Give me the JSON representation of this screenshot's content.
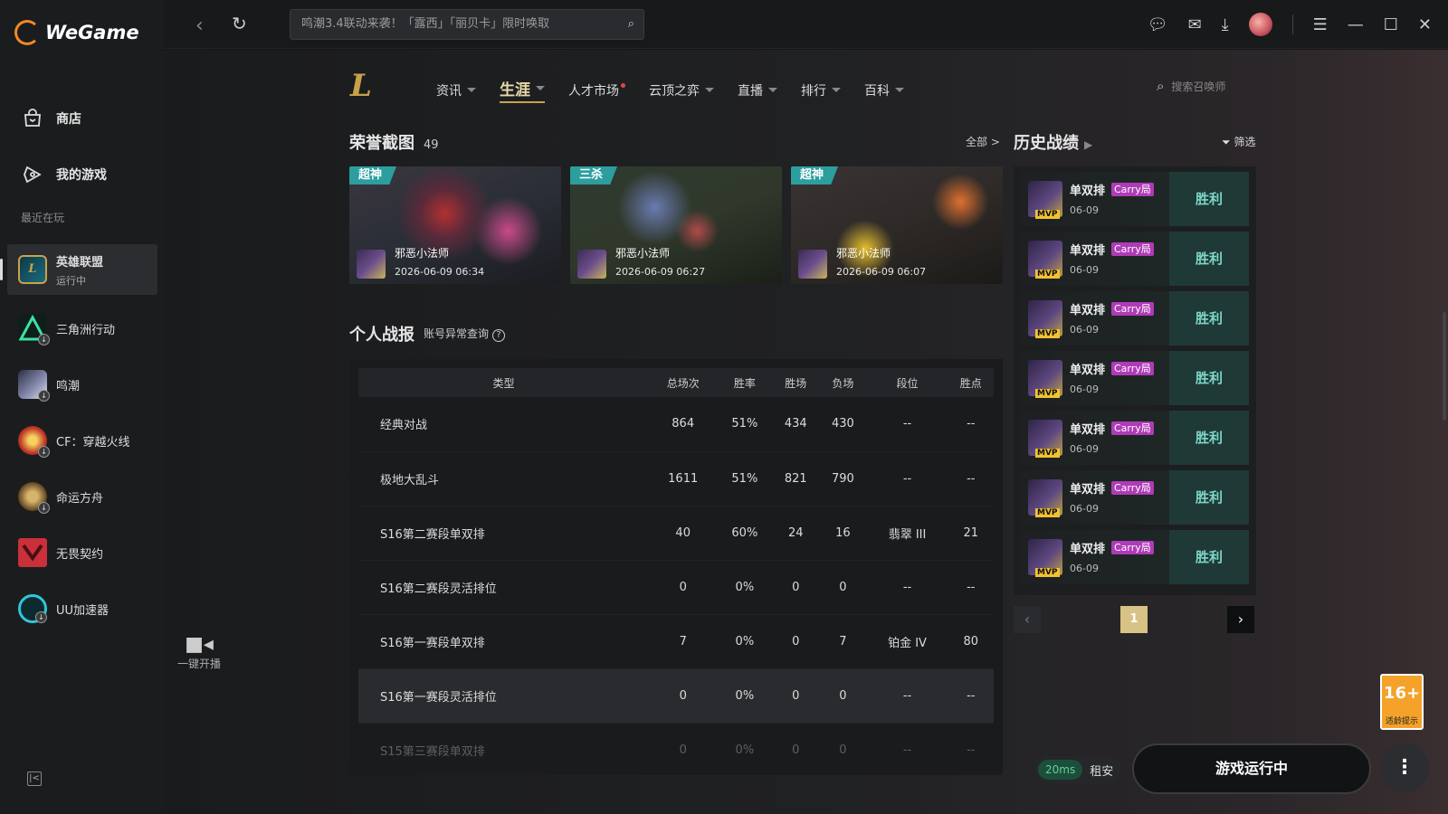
{
  "app": {
    "name": "WeGame"
  },
  "sidebar": {
    "nav": [
      {
        "label": "商店",
        "icon": "shop-icon"
      },
      {
        "label": "我的游戏",
        "icon": "gamepad-icon"
      }
    ],
    "recent_title": "最近在玩",
    "games": [
      {
        "name": "英雄联盟",
        "status": "运行中",
        "icon": "league-of-legends-icon",
        "active": true
      },
      {
        "name": "三角洲行动",
        "icon": "delta-force-icon"
      },
      {
        "name": "鸣潮",
        "icon": "wuthering-waves-icon"
      },
      {
        "name": "CF：穿越火线",
        "icon": "crossfire-icon"
      },
      {
        "name": "命运方舟",
        "icon": "lost-ark-icon"
      },
      {
        "name": "无畏契约",
        "icon": "valorant-icon"
      },
      {
        "name": "UU加速器",
        "icon": "uu-accelerator-icon"
      }
    ]
  },
  "topbar": {
    "search_text": "鸣潮3.4联动来袭！「露西」「丽贝卡」限时唤取"
  },
  "lol_nav": {
    "items": [
      {
        "label": "资讯",
        "caret": true
      },
      {
        "label": "生涯",
        "caret": true,
        "active": true
      },
      {
        "label": "人才市场",
        "caret": false,
        "dot": true
      },
      {
        "label": "云顶之弈",
        "caret": true
      },
      {
        "label": "直播",
        "caret": true
      },
      {
        "label": "排行",
        "caret": true
      },
      {
        "label": "百科",
        "caret": true
      }
    ],
    "summoner_search_placeholder": "搜索召唤师"
  },
  "honor": {
    "title": "荣誉截图",
    "count": "49",
    "all_link": "全部 >",
    "shots": [
      {
        "badge": "超神",
        "player": "邪恶小法师",
        "time": "2026-06-09 06:34"
      },
      {
        "badge": "三杀",
        "player": "邪恶小法师",
        "time": "2026-06-09 06:27"
      },
      {
        "badge": "超神",
        "player": "邪恶小法师",
        "time": "2026-06-09 06:07"
      }
    ]
  },
  "stats": {
    "title": "个人战报",
    "query_link": "账号异常查询",
    "headers": [
      "类型",
      "总场次",
      "胜率",
      "胜场",
      "负场",
      "段位",
      "胜点"
    ],
    "rows": [
      [
        "经典对战",
        "864",
        "51%",
        "434",
        "430",
        "--",
        "--"
      ],
      [
        "极地大乱斗",
        "1611",
        "51%",
        "821",
        "790",
        "--",
        "--"
      ],
      [
        "S16第二赛段单双排",
        "40",
        "60%",
        "24",
        "16",
        "翡翠 III",
        "21"
      ],
      [
        "S16第二赛段灵活排位",
        "0",
        "0%",
        "0",
        "0",
        "--",
        "--"
      ],
      [
        "S16第一赛段单双排",
        "7",
        "0%",
        "0",
        "7",
        "铂金 IV",
        "80"
      ],
      [
        "S16第一赛段灵活排位",
        "0",
        "0%",
        "0",
        "0",
        "--",
        "--"
      ],
      [
        "S15第三赛段单双排",
        "0",
        "0%",
        "0",
        "0",
        "--",
        "--"
      ]
    ]
  },
  "history": {
    "title": "历史战绩",
    "filter_label": "筛选",
    "matches": [
      {
        "mode": "单双排",
        "tag": "Carry局",
        "date": "06-09",
        "result": "胜利",
        "mvp": "MVP"
      },
      {
        "mode": "单双排",
        "tag": "Carry局",
        "date": "06-09",
        "result": "胜利",
        "mvp": "MVP"
      },
      {
        "mode": "单双排",
        "tag": "Carry局",
        "date": "06-09",
        "result": "胜利",
        "mvp": "MVP"
      },
      {
        "mode": "单双排",
        "tag": "Carry局",
        "date": "06-09",
        "result": "胜利",
        "mvp": "MVP"
      },
      {
        "mode": "单双排",
        "tag": "Carry局",
        "date": "06-09",
        "result": "胜利",
        "mvp": "MVP"
      },
      {
        "mode": "单双排",
        "tag": "Carry局",
        "date": "06-09",
        "result": "胜利",
        "mvp": "MVP"
      },
      {
        "mode": "单双排",
        "tag": "Carry局",
        "date": "06-09",
        "result": "胜利",
        "mvp": "MVP"
      }
    ],
    "page": "1"
  },
  "broadcast": {
    "label": "一键开播"
  },
  "bottom": {
    "ping": "20ms",
    "location": "租安",
    "run_button": "游戏运行中",
    "age_rating": "16+",
    "age_sub": "适龄提示"
  }
}
